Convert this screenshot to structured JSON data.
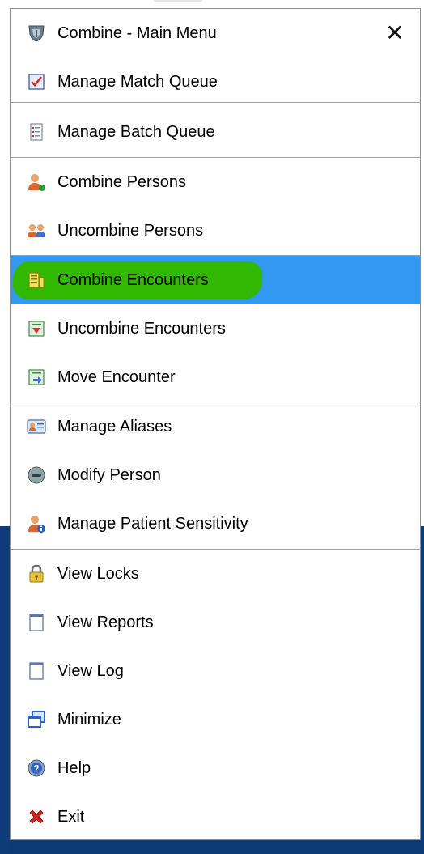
{
  "menu": {
    "title": "Combine - Main Menu",
    "close_glyph": "✕",
    "items": [
      {
        "label": "Manage Match Queue",
        "icon": "checklist-icon"
      },
      {
        "label": "Manage Batch Queue",
        "icon": "batch-list-icon"
      },
      {
        "label": "Combine Persons",
        "icon": "person-combine-icon"
      },
      {
        "label": "Uncombine Persons",
        "icon": "persons-uncombine-icon"
      },
      {
        "label": "Combine Encounters",
        "icon": "encounters-combine-icon",
        "selected": true
      },
      {
        "label": "Uncombine Encounters",
        "icon": "encounters-uncombine-icon"
      },
      {
        "label": "Move Encounter",
        "icon": "move-encounter-icon"
      },
      {
        "label": "Manage Aliases",
        "icon": "aliases-card-icon"
      },
      {
        "label": "Modify Person",
        "icon": "modify-person-icon"
      },
      {
        "label": "Manage Patient Sensitivity",
        "icon": "patient-sensitivity-icon"
      },
      {
        "label": "View Locks",
        "icon": "lock-icon"
      },
      {
        "label": "View Reports",
        "icon": "document-icon"
      },
      {
        "label": "View Log",
        "icon": "log-document-icon"
      },
      {
        "label": "Minimize",
        "icon": "minimize-windows-icon"
      },
      {
        "label": "Help",
        "icon": "help-icon"
      },
      {
        "label": "Exit",
        "icon": "exit-x-icon"
      }
    ]
  },
  "colors": {
    "selection_blue": "#3399f0",
    "highlight_green": "#33b800",
    "background_blue": "#0d3c79"
  }
}
